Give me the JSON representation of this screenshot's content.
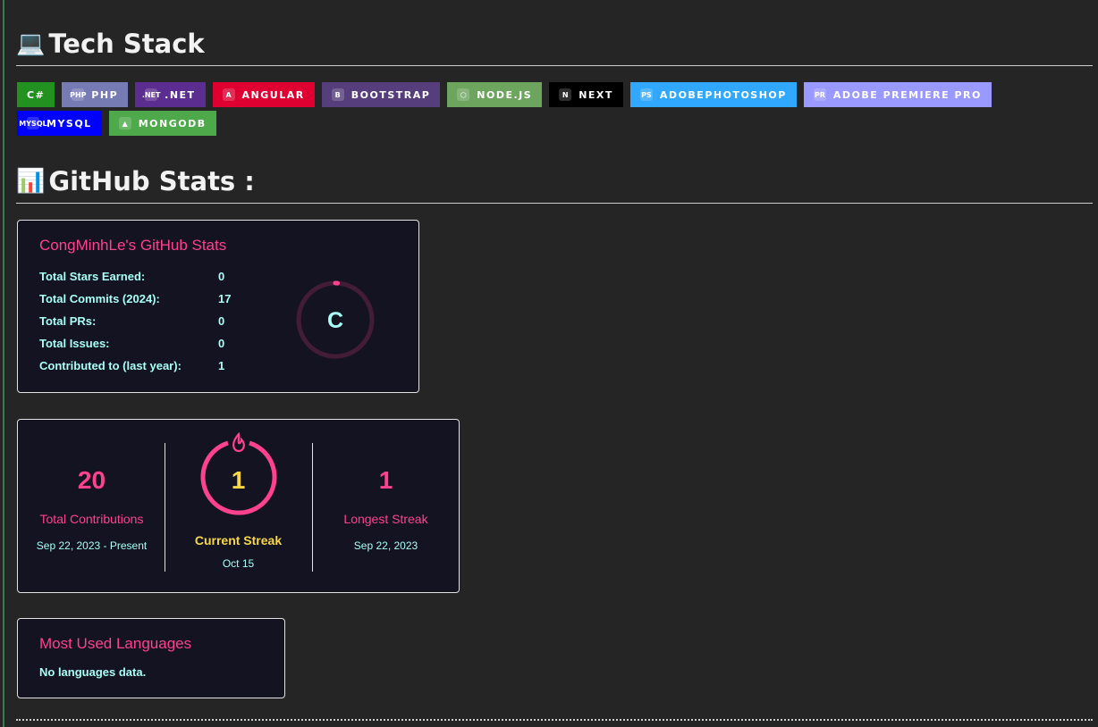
{
  "tech_stack": {
    "emoji": "💻",
    "title": "Tech Stack",
    "badges": [
      {
        "label": "C#",
        "color": "#239120",
        "icon": ""
      },
      {
        "label": "PHP",
        "color": "#777BB4",
        "icon": "php"
      },
      {
        "label": ".NET",
        "color": "#5C2D91",
        "icon": ".NET"
      },
      {
        "label": "ANGULAR",
        "color": "#DD0031",
        "icon": "A"
      },
      {
        "label": "BOOTSTRAP",
        "color": "#563D7C",
        "icon": "B"
      },
      {
        "label": "NODE.JS",
        "color": "#6DA55F",
        "icon": "⬡"
      },
      {
        "label": "NEXT",
        "color": "#000000",
        "icon": "N"
      },
      {
        "label": "ADOBEPHOTOSHOP",
        "color": "#31A8FF",
        "icon": "Ps"
      },
      {
        "label": "ADOBE PREMIERE PRO",
        "color": "#9999FF",
        "icon": "Pr"
      },
      {
        "label": "MYSQL",
        "color": "#0000FF",
        "icon": "MySQL"
      },
      {
        "label": "MONGODB",
        "color": "#4EA94B",
        "icon": "▲"
      }
    ]
  },
  "github_stats": {
    "emoji": "📊",
    "title": "GitHub Stats :"
  },
  "stats_card": {
    "title": "CongMinhLe's GitHub Stats",
    "rows": [
      {
        "label": "Total Stars Earned:",
        "value": "0"
      },
      {
        "label": "Total Commits (2024):",
        "value": "17"
      },
      {
        "label": "Total PRs:",
        "value": "0"
      },
      {
        "label": "Total Issues:",
        "value": "0"
      },
      {
        "label": "Contributed to (last year):",
        "value": "1"
      }
    ],
    "rank": "C",
    "rank_progress": 0.01
  },
  "streak_card": {
    "total": {
      "value": "20",
      "label": "Total Contributions",
      "range": "Sep 22, 2023 - Present"
    },
    "current": {
      "value": "1",
      "label": "Current Streak",
      "range": "Oct 15"
    },
    "longest": {
      "value": "1",
      "label": "Longest Streak",
      "range": "Sep 22, 2023"
    }
  },
  "languages_card": {
    "title": "Most Used Languages",
    "empty": "No languages data."
  },
  "colors": {
    "title": "#fe428e",
    "text": "#a9fef7",
    "streak": "#f8d847",
    "card_bg": "#141321"
  }
}
